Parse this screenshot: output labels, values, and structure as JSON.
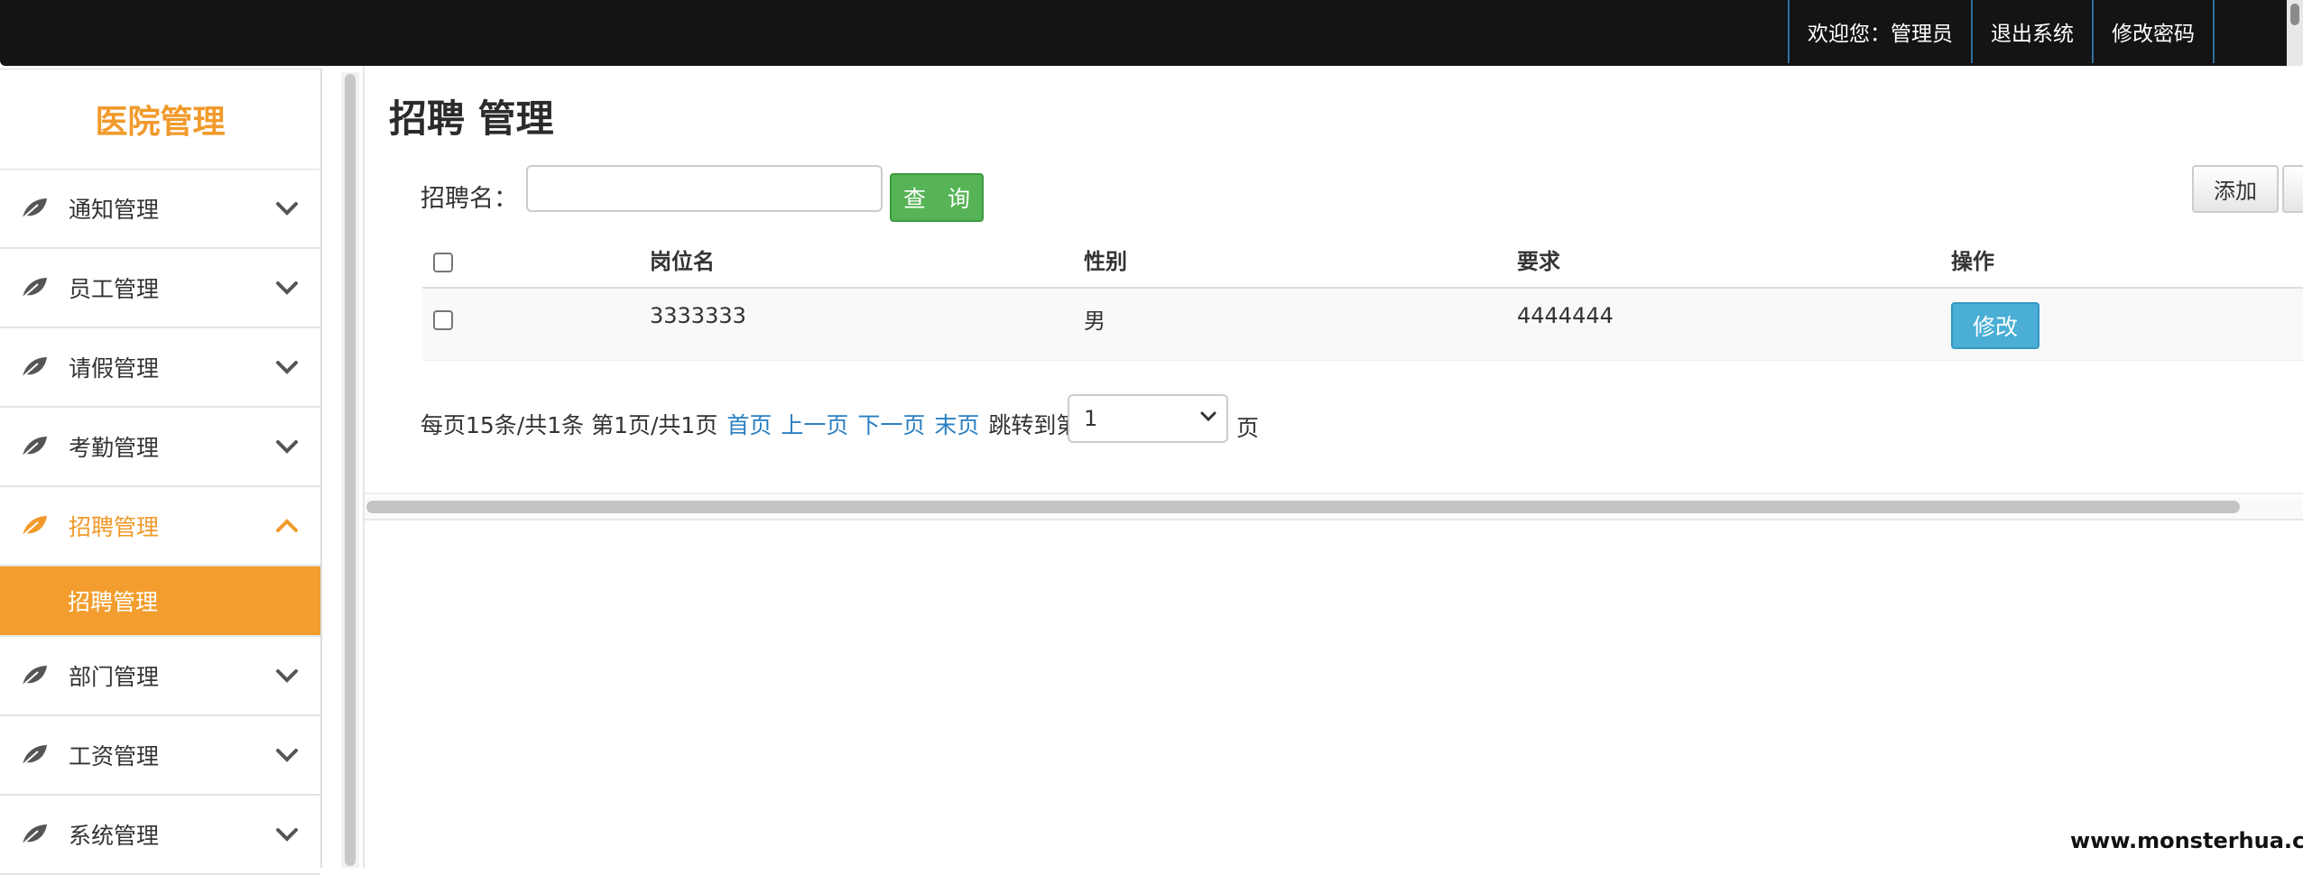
{
  "topbar": {
    "welcome": "欢迎您：管理员",
    "logout": "退出系统",
    "change_password": "修改密码"
  },
  "sidebar": {
    "brand": "医院管理",
    "items": [
      {
        "label": "通知管理",
        "icon": "leaf-icon",
        "expanded": false
      },
      {
        "label": "员工管理",
        "icon": "leaf-icon",
        "expanded": false
      },
      {
        "label": "请假管理",
        "icon": "leaf-icon",
        "expanded": false
      },
      {
        "label": "考勤管理",
        "icon": "leaf-icon",
        "expanded": false
      },
      {
        "label": "招聘管理",
        "icon": "leaf-icon",
        "expanded": true
      },
      {
        "label": "部门管理",
        "icon": "leaf-icon",
        "expanded": false
      },
      {
        "label": "工资管理",
        "icon": "leaf-icon",
        "expanded": false
      },
      {
        "label": "系统管理",
        "icon": "leaf-icon",
        "expanded": false
      }
    ],
    "submenu": [
      {
        "label": "招聘管理",
        "selected": true
      }
    ]
  },
  "main": {
    "title": "招聘 管理",
    "search": {
      "label": "招聘名：",
      "value": "",
      "button": "查 询"
    },
    "add_button": "添加",
    "table": {
      "headers": [
        "岗位名",
        "性别",
        "要求",
        "操作"
      ],
      "rows": [
        {
          "name": "3333333",
          "gender": "男",
          "requirement": "4444444",
          "action": "修改"
        }
      ]
    },
    "pager": {
      "summary": "每页15条/共1条 第1页/共1页",
      "first": "首页",
      "prev": "上一页",
      "next": "下一页",
      "last": "末页",
      "jump_prefix": "跳转到第",
      "jump_value": "1",
      "jump_suffix": "页"
    }
  },
  "watermark": "www.monsterhua.com",
  "colors": {
    "accent": "#f19a2b",
    "topbar": "#141414",
    "query_button": "#56b356",
    "edit_button": "#4aaed6",
    "link": "#2a7fc1"
  }
}
